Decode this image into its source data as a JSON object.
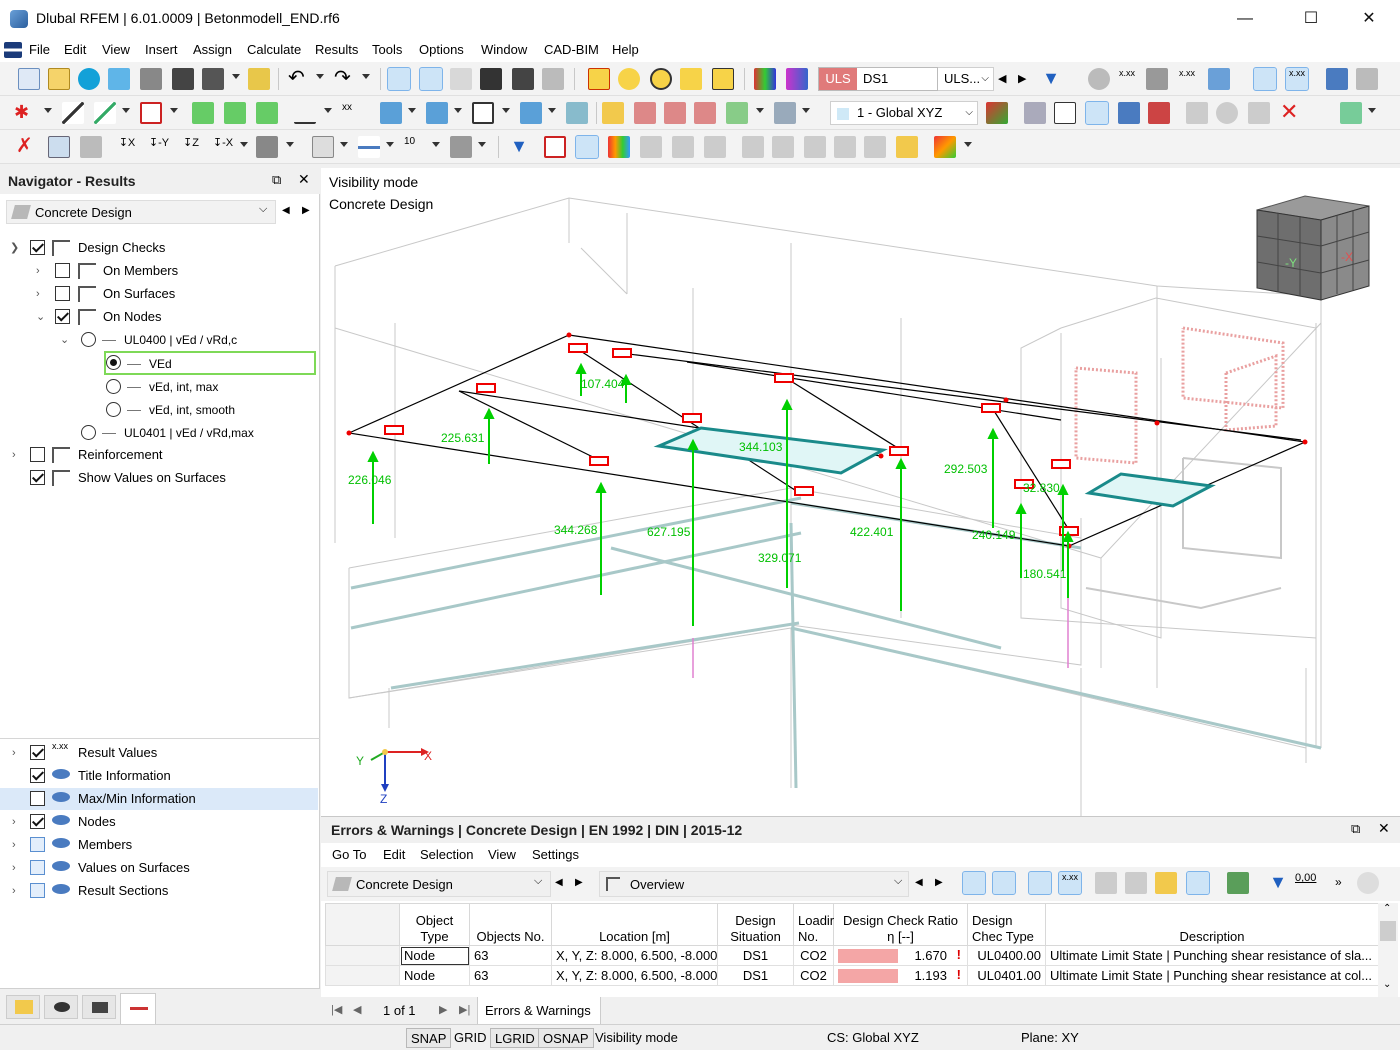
{
  "window": {
    "title": "Dlubal RFEM | 6.01.0009 | Betonmodell_END.rf6",
    "minimize": "—",
    "maximize": "☐",
    "close": "✕"
  },
  "menu": [
    "File",
    "Edit",
    "View",
    "Insert",
    "Assign",
    "Calculate",
    "Results",
    "Tools",
    "Options",
    "Window",
    "CAD-BIM",
    "Help"
  ],
  "toolbar": {
    "uls_badge": "ULS",
    "design_situation": "DS1",
    "combo_value": "ULS...",
    "coordinate_system": "1 - Global XYZ",
    "result_label": "x.xx"
  },
  "navigator": {
    "title": "Navigator - Results",
    "dropdown": "Concrete Design",
    "tree": {
      "design_checks": "Design Checks",
      "on_members": "On Members",
      "on_surfaces": "On Surfaces",
      "on_nodes": "On Nodes",
      "ul0400": "UL0400 | vEd / vRd,c",
      "ved": "VEd",
      "ved_int_max": "vEd, int, max",
      "ved_int_smooth": "vEd, int, smooth",
      "ul0401": "UL0401 | vEd / vRd,max",
      "reinforcement": "Reinforcement",
      "show_values": "Show Values on Surfaces"
    },
    "display": {
      "result_values": "Result Values",
      "title_information": "Title Information",
      "maxmin_information": "Max/Min Information",
      "nodes": "Nodes",
      "members": "Members",
      "values_on_surfaces": "Values on Surfaces",
      "result_sections": "Result Sections"
    }
  },
  "viewport": {
    "line1": "Visibility mode",
    "line2": "Concrete Design",
    "axis_x": "X",
    "axis_y": "Y",
    "axis_z": "Z",
    "cube_y": "-Y",
    "cube_x": "-X",
    "values": [
      "226.046",
      "225.631",
      "107.404",
      "344.268",
      "627.195",
      "344.103",
      "329.071",
      "422.401",
      "292.503",
      "240.149",
      "32.830",
      "180.541"
    ]
  },
  "errors_panel": {
    "title": "Errors & Warnings | Concrete Design | EN 1992 | DIN | 2015-12",
    "menu": [
      "Go To",
      "Edit",
      "Selection",
      "View",
      "Settings"
    ],
    "module": "Concrete Design",
    "view": "Overview",
    "zero_label": "0,00",
    "columns": [
      "Object Type",
      "Objects No.",
      "Location [m]",
      "Design Situation",
      "Loadir No.",
      "Design Check Ratio η [--]",
      "Design Chec Type",
      "Description"
    ],
    "rows": [
      {
        "type": "Node",
        "no": "63",
        "location": "X, Y, Z: 8.000, 6.500, -8.000",
        "situation": "DS1",
        "load": "CO2",
        "ratio": "1.670",
        "check": "UL0400.00",
        "desc": "Ultimate Limit State | Punching shear resistance of sla..."
      },
      {
        "type": "Node",
        "no": "63",
        "location": "X, Y, Z: 8.000, 6.500, -8.000",
        "situation": "DS1",
        "load": "CO2",
        "ratio": "1.193",
        "check": "UL0401.00",
        "desc": "Ultimate Limit State | Punching shear resistance at col..."
      }
    ],
    "pager": "1 of 1",
    "tab": "Errors & Warnings"
  },
  "statusbar": {
    "snap": "SNAP",
    "grid": "GRID",
    "lgrid": "LGRID",
    "osnap": "OSNAP",
    "mode": "Visibility mode",
    "cs": "CS: Global XYZ",
    "plane": "Plane: XY"
  },
  "colors": {
    "accent": "#0078d7",
    "result_arrow": "#00d000",
    "node_marker": "#ff0000",
    "ratio_bar": "#f4a6a6",
    "selection_green": "#7ed957"
  }
}
